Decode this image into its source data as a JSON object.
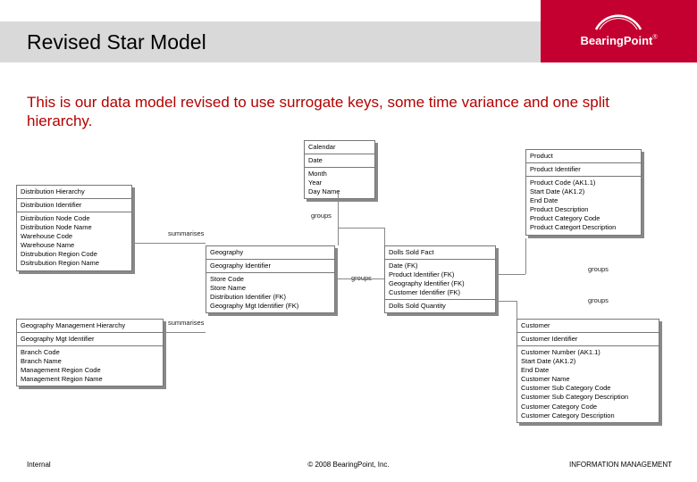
{
  "header": {
    "title": "Revised Star Model",
    "brand": "BearingPoint"
  },
  "subtitle": "This is our data model revised to use surrogate keys, some time variance and one split hierarchy.",
  "entities": {
    "calendar": {
      "title": "Calendar",
      "key": "Date",
      "attrs": [
        "Month",
        "Year",
        "Day Name"
      ]
    },
    "product": {
      "title": "Product",
      "key": "Product Identifier",
      "attrs": [
        "Product Code (AK1.1)",
        "Start Date (AK1.2)",
        "End Date",
        "Product Description",
        "Product Category Code",
        "Product Categort Description"
      ]
    },
    "dist": {
      "title": "Distribution Hierarchy",
      "key": "Distribution Identifier",
      "attrs": [
        "Distribution Node Code",
        "Distribution Node Name",
        "Warehouse Code",
        "Warehouse Name",
        "Distrubution Region Code",
        "Dsitrubution Region Name"
      ]
    },
    "geo": {
      "title": "Geography",
      "key": "Geography Identifier",
      "attrs": [
        "Store Code",
        "Store Name",
        "Distribution Identifier (FK)",
        "Geography Mgt Identifier (FK)"
      ]
    },
    "fact": {
      "title": "Dolls Sold Fact",
      "key": "Date (FK)\nProduct Identifier (FK)\nGeography Identifier (FK)\nCustomer Identifier (FK)",
      "attrs": [
        "Dolls Sold Quantity"
      ]
    },
    "geomgt": {
      "title": "Geography Management Hierarchy",
      "key": "Geography Mgt Identifier",
      "attrs": [
        "Branch Code",
        "Branch Name",
        "Management Region Code",
        "Management Region Name"
      ]
    },
    "cust": {
      "title": "Customer",
      "key": "Customer Identifier",
      "attrs": [
        "Customer Number (AK1.1)",
        "Start Date (AK1.2)",
        "End Date",
        "Customer Name",
        "Customer Sub Category Code",
        "Customer Sub Category Description",
        "Customer Category Code",
        "Customer Category Description"
      ]
    }
  },
  "rel": {
    "summarises1": "summarises",
    "summarises2": "summarises",
    "groups1": "groups",
    "groups2": "groups",
    "groups3": "groups",
    "groups4": "groups"
  },
  "footer": {
    "left": "Internal",
    "center": "© 2008 BearingPoint, Inc.",
    "right": "INFORMATION MANAGEMENT"
  }
}
